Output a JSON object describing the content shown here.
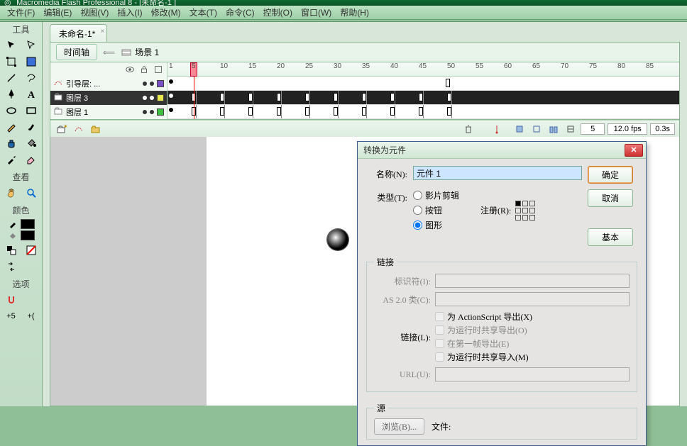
{
  "title": "Macromedia Flash Professional 8 - [未命名-1 ]",
  "menu": [
    "文件(F)",
    "编辑(E)",
    "视图(V)",
    "插入(I)",
    "修改(M)",
    "文本(T)",
    "命令(C)",
    "控制(O)",
    "窗口(W)",
    "帮助(H)"
  ],
  "tools_header": "工具",
  "view_header": "查看",
  "color_header": "颜色",
  "options_header": "选项",
  "doc_tab": "未命名-1*",
  "scene_btn": "时间轴",
  "scene_label": "场景 1",
  "layers": [
    {
      "name": "引导层: ...",
      "color": "#7a4fc4",
      "sel": false,
      "guide": true
    },
    {
      "name": "图层 3",
      "color": "#e8e84a",
      "sel": true,
      "guide": false
    },
    {
      "name": "图层 1",
      "color": "#3fbf3f",
      "sel": false,
      "guide": false
    }
  ],
  "ruler_ticks": [
    1,
    5,
    10,
    15,
    20,
    25,
    30,
    35,
    40,
    45,
    50,
    55,
    60,
    65,
    70,
    75,
    80,
    85
  ],
  "playhead_frame": 5,
  "tl_footer": {
    "frame": "5",
    "fps": "12.0 fps",
    "time": "0.3s"
  },
  "dialog": {
    "title": "转换为元件",
    "name_lbl": "名称(N):",
    "name_val": "元件 1",
    "type_lbl": "类型(T):",
    "types": [
      "影片剪辑",
      "按钮",
      "图形"
    ],
    "type_sel": 2,
    "reg_lbl": "注册(R):",
    "ok": "确定",
    "cancel": "取消",
    "basic": "基本",
    "link_legend": "链接",
    "ident_lbl": "标识符(I):",
    "as2_lbl": "AS 2.0 类(C):",
    "link_lbl": "链接(L):",
    "link_opts": [
      "为 ActionScript 导出(X)",
      "为运行时共享导出(O)",
      "在第一帧导出(E)",
      "为运行时共享导入(M)"
    ],
    "url_lbl": "URL(U):",
    "src_legend": "源",
    "browse": "浏览(B)...",
    "file_lbl": "文件:"
  }
}
